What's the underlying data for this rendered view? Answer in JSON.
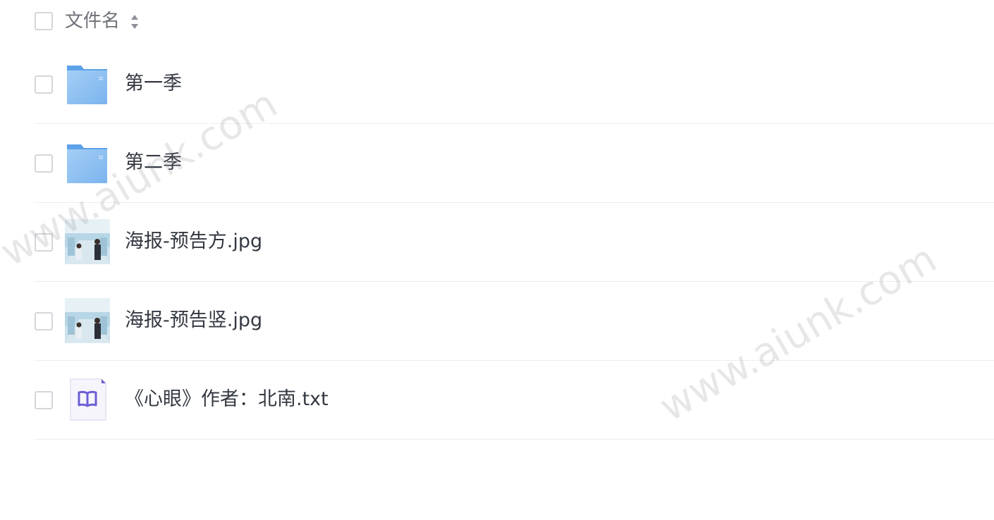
{
  "header": {
    "column_label": "文件名"
  },
  "rows": [
    {
      "name": "第一季",
      "type": "folder",
      "icon": "folder-icon"
    },
    {
      "name": "第二季",
      "type": "folder",
      "icon": "folder-icon"
    },
    {
      "name": "海报-预告方.jpg",
      "type": "image",
      "icon": "image-thumbnail"
    },
    {
      "name": "海报-预告竖.jpg",
      "type": "image",
      "icon": "image-thumbnail"
    },
    {
      "name": "《心眼》作者：北南.txt",
      "type": "text",
      "icon": "book-icon"
    }
  ],
  "watermark": {
    "text": "www.aiunk.com"
  },
  "colors": {
    "folder": "#7fb6f0",
    "book_accent": "#6b5fd3",
    "divider": "#eceef0"
  }
}
